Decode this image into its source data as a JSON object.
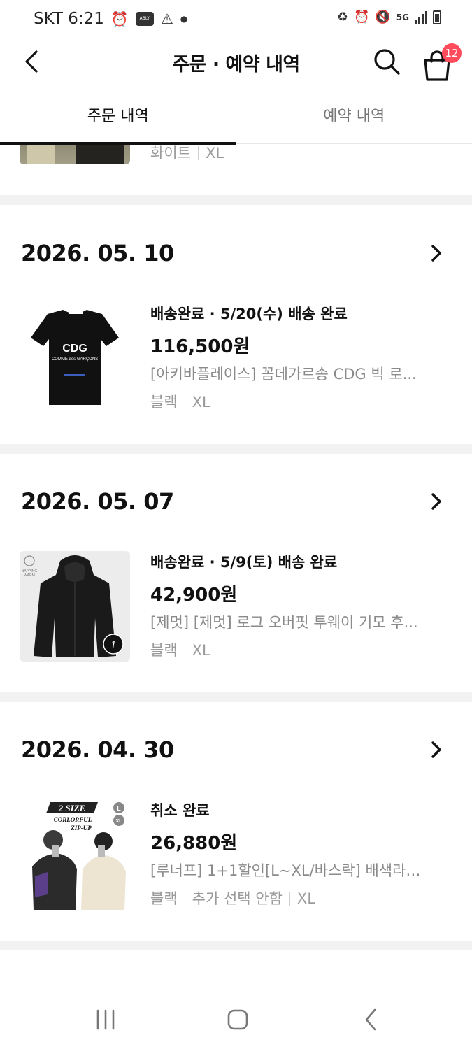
{
  "status_bar": {
    "carrier_time": "SKT 6:21",
    "app_badge": "ABLY",
    "network": "5G"
  },
  "header": {
    "title": "주문 · 예약 내역",
    "cart_count": "12"
  },
  "tabs": [
    {
      "label": "주문 내역",
      "active": true
    },
    {
      "label": "예약 내역",
      "active": false
    }
  ],
  "partial_item": {
    "options": [
      "화이트",
      "XL"
    ]
  },
  "orders": [
    {
      "date": "2026. 05. 10",
      "status": "배송완료 · 5/20(수) 배송 완료",
      "price": "116,500원",
      "name": "[아키바플레이스] 꼼데가르송 CDG 빅 로고 반팔 티셔츠",
      "name_display": "[아키바플레이스] 꼼데가르송 CDG 빅 로...",
      "options": [
        "블랙",
        "XL"
      ],
      "thumb_text": {
        "logo": "CDG",
        "sub": "COMME des GARÇONS"
      }
    },
    {
      "date": "2026. 05. 07",
      "status": "배송완료 · 5/9(토) 배송 완료",
      "price": "42,900원",
      "name_display": "[제멋] [제멋] 로그 오버핏 투웨이 기모 후...",
      "options": [
        "블랙",
        "XL"
      ],
      "thumb_text": {
        "brand_top": "NAPPING",
        "brand_bottom": "WARM",
        "corner_mark": "1"
      }
    },
    {
      "date": "2026. 04. 30",
      "status": "취소 완료",
      "price": "26,880원",
      "name_display": "[루너프] 1+1할인[L~XL/바스락] 배색라인...",
      "options": [
        "블랙",
        "추가 선택 안함",
        "XL"
      ],
      "thumb_text": {
        "size": "2 SIZE",
        "line1": "CORLORFUL",
        "line2": "ZIP-UP",
        "badge_l": "L",
        "badge_xl": "XL"
      }
    }
  ],
  "colors": {
    "badge": "#ff4b5c",
    "divider": "#f2f2f2",
    "muted_text": "#8a8a8a"
  }
}
